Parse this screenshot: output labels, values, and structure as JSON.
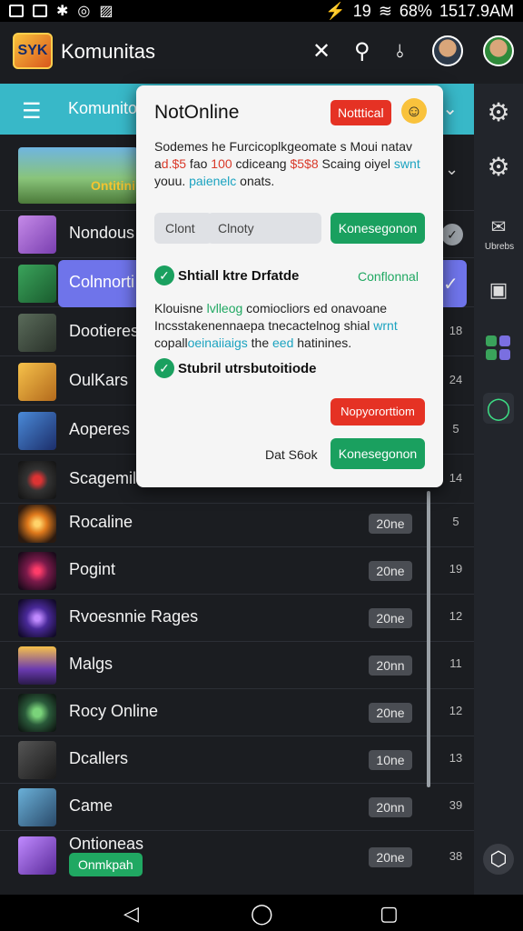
{
  "status_bar": {
    "time": "1517.9AM",
    "battery": "68%",
    "signal": "19"
  },
  "app_bar": {
    "logo": "SYK",
    "title": "Komunitas"
  },
  "sub_header": {
    "title": "Komunito"
  },
  "dialog": {
    "title": "NotOnline",
    "tag_button": "Notttical",
    "para1_line1": "Sodemes he Furcicoplkgeomate s Moui natav",
    "para1_a": "a",
    "para1_b": "d.$5",
    "para1_c": " fao ",
    "para1_d": "100",
    "para1_e": " cdiceang ",
    "para1_f": "$5$8",
    "para1_g": " Scaing oiyel ",
    "para1_h": "swnt",
    "para1_line3_a": "youu. ",
    "para1_line3_b": "paienelc",
    "para1_line3_c": " onats.",
    "field1": "Clont",
    "field2": "Clnoty",
    "field_button": "Konesegonon",
    "option1_label": "Shtiall ktre Drfatde",
    "option1_status": "Conflonnal",
    "para2_line1_a": "Klouisne ",
    "para2_line1_b": "lvlleog",
    "para2_line1_c": " comiocliors ed onavoane",
    "para2_line2_a": "Incsstakenennaepa tnecactelnog shial ",
    "para2_line2_b": "wrnt",
    "para2_line3_a": "copall",
    "para2_line3_b": "oeinaiiaigs",
    "para2_line3_c": " the ",
    "para2_line3_d": "eed",
    "para2_line3_e": " hatinines.",
    "option2_label": "Stubril utrsbutoitiode",
    "red_button": "Nopyororttiom",
    "secondary": "Dat S6ok",
    "primary_button": "Konesegonon"
  },
  "right_rail": {
    "label1": "Ubrebs"
  },
  "list": {
    "featured": {
      "name": "Ontitini"
    },
    "rows": [
      {
        "name": "Nondous",
        "count": ""
      },
      {
        "name": "Colnnorti",
        "count": ""
      },
      {
        "name": "Dootieres",
        "count": "18"
      },
      {
        "name": "OulKars",
        "count": "24"
      },
      {
        "name": "Aoperes",
        "count": "5"
      },
      {
        "name": "Scagemil",
        "count": "14"
      },
      {
        "name": "Rocaline",
        "tag": "20ne",
        "count": "5"
      },
      {
        "name": "Pogint",
        "tag": "20ne",
        "count": "19"
      },
      {
        "name": "Rvoesnnie Rages",
        "tag": "20ne",
        "count": "12"
      },
      {
        "name": "Malgs",
        "tag": "20nn",
        "count": "11"
      },
      {
        "name": "Rocy Online",
        "tag": "20ne",
        "count": "12"
      },
      {
        "name": "Dcallers",
        "tag": "10ne",
        "count": "13"
      },
      {
        "name": "Came",
        "tag": "20nn",
        "count": "39"
      },
      {
        "name": "Ontioneas",
        "tag": "20ne",
        "count": "38",
        "badge": "Onmkpah"
      }
    ]
  }
}
